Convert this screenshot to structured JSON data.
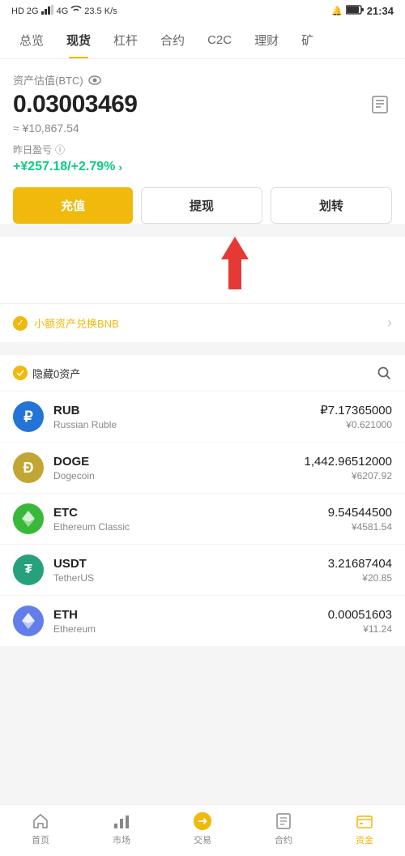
{
  "statusBar": {
    "left": "HD 2G 26 4G",
    "wifiSpeed": "23.5 K/s",
    "time": "21:34"
  },
  "navTabs": {
    "items": [
      {
        "label": "总览",
        "active": false
      },
      {
        "label": "现货",
        "active": true
      },
      {
        "label": "杠杆",
        "active": false
      },
      {
        "label": "合约",
        "active": false
      },
      {
        "label": "C2C",
        "active": false
      },
      {
        "label": "理财",
        "active": false
      },
      {
        "label": "矿",
        "active": false
      }
    ]
  },
  "assetSection": {
    "label": "资产估值(BTC)",
    "btcValue": "0.03003469",
    "approxSign": "≈",
    "cnyValue": "¥10,867.54",
    "pnlLabel": "昨日盈亏",
    "pnlValue": "+¥257.18/+2.79%"
  },
  "actionButtons": {
    "deposit": "充值",
    "withdraw": "提现",
    "transfer": "划转"
  },
  "bnbBanner": {
    "text": "小额资产兑换BNB"
  },
  "assetList": {
    "hideZeroLabel": "隐藏0资产",
    "items": [
      {
        "symbol": "RUB",
        "name": "Russian Ruble",
        "amount": "₽7.17365000",
        "cnyValue": "¥0.621000",
        "iconType": "rub",
        "iconSymbol": "₽"
      },
      {
        "symbol": "DOGE",
        "name": "Dogecoin",
        "amount": "1,442.96512000",
        "cnyValue": "¥6207.92",
        "iconType": "doge",
        "iconSymbol": "Ð"
      },
      {
        "symbol": "ETC",
        "name": "Ethereum Classic",
        "amount": "9.54544500",
        "cnyValue": "¥4581.54",
        "iconType": "etc",
        "iconSymbol": "◈"
      },
      {
        "symbol": "USDT",
        "name": "TetherUS",
        "amount": "3.21687404",
        "cnyValue": "¥20.85",
        "iconType": "usdt",
        "iconSymbol": "₮"
      },
      {
        "symbol": "ETH",
        "name": "Ethereum",
        "amount": "0.00051603",
        "cnyValue": "¥11.24",
        "iconType": "eth",
        "iconSymbol": "Ξ"
      }
    ]
  },
  "bottomNav": {
    "items": [
      {
        "label": "首页",
        "icon": "🏠",
        "active": false
      },
      {
        "label": "市场",
        "icon": "📊",
        "active": false
      },
      {
        "label": "交易",
        "icon": "🔄",
        "active": false
      },
      {
        "label": "合约",
        "icon": "📋",
        "active": false
      },
      {
        "label": "资金",
        "icon": "💼",
        "active": true
      }
    ]
  }
}
